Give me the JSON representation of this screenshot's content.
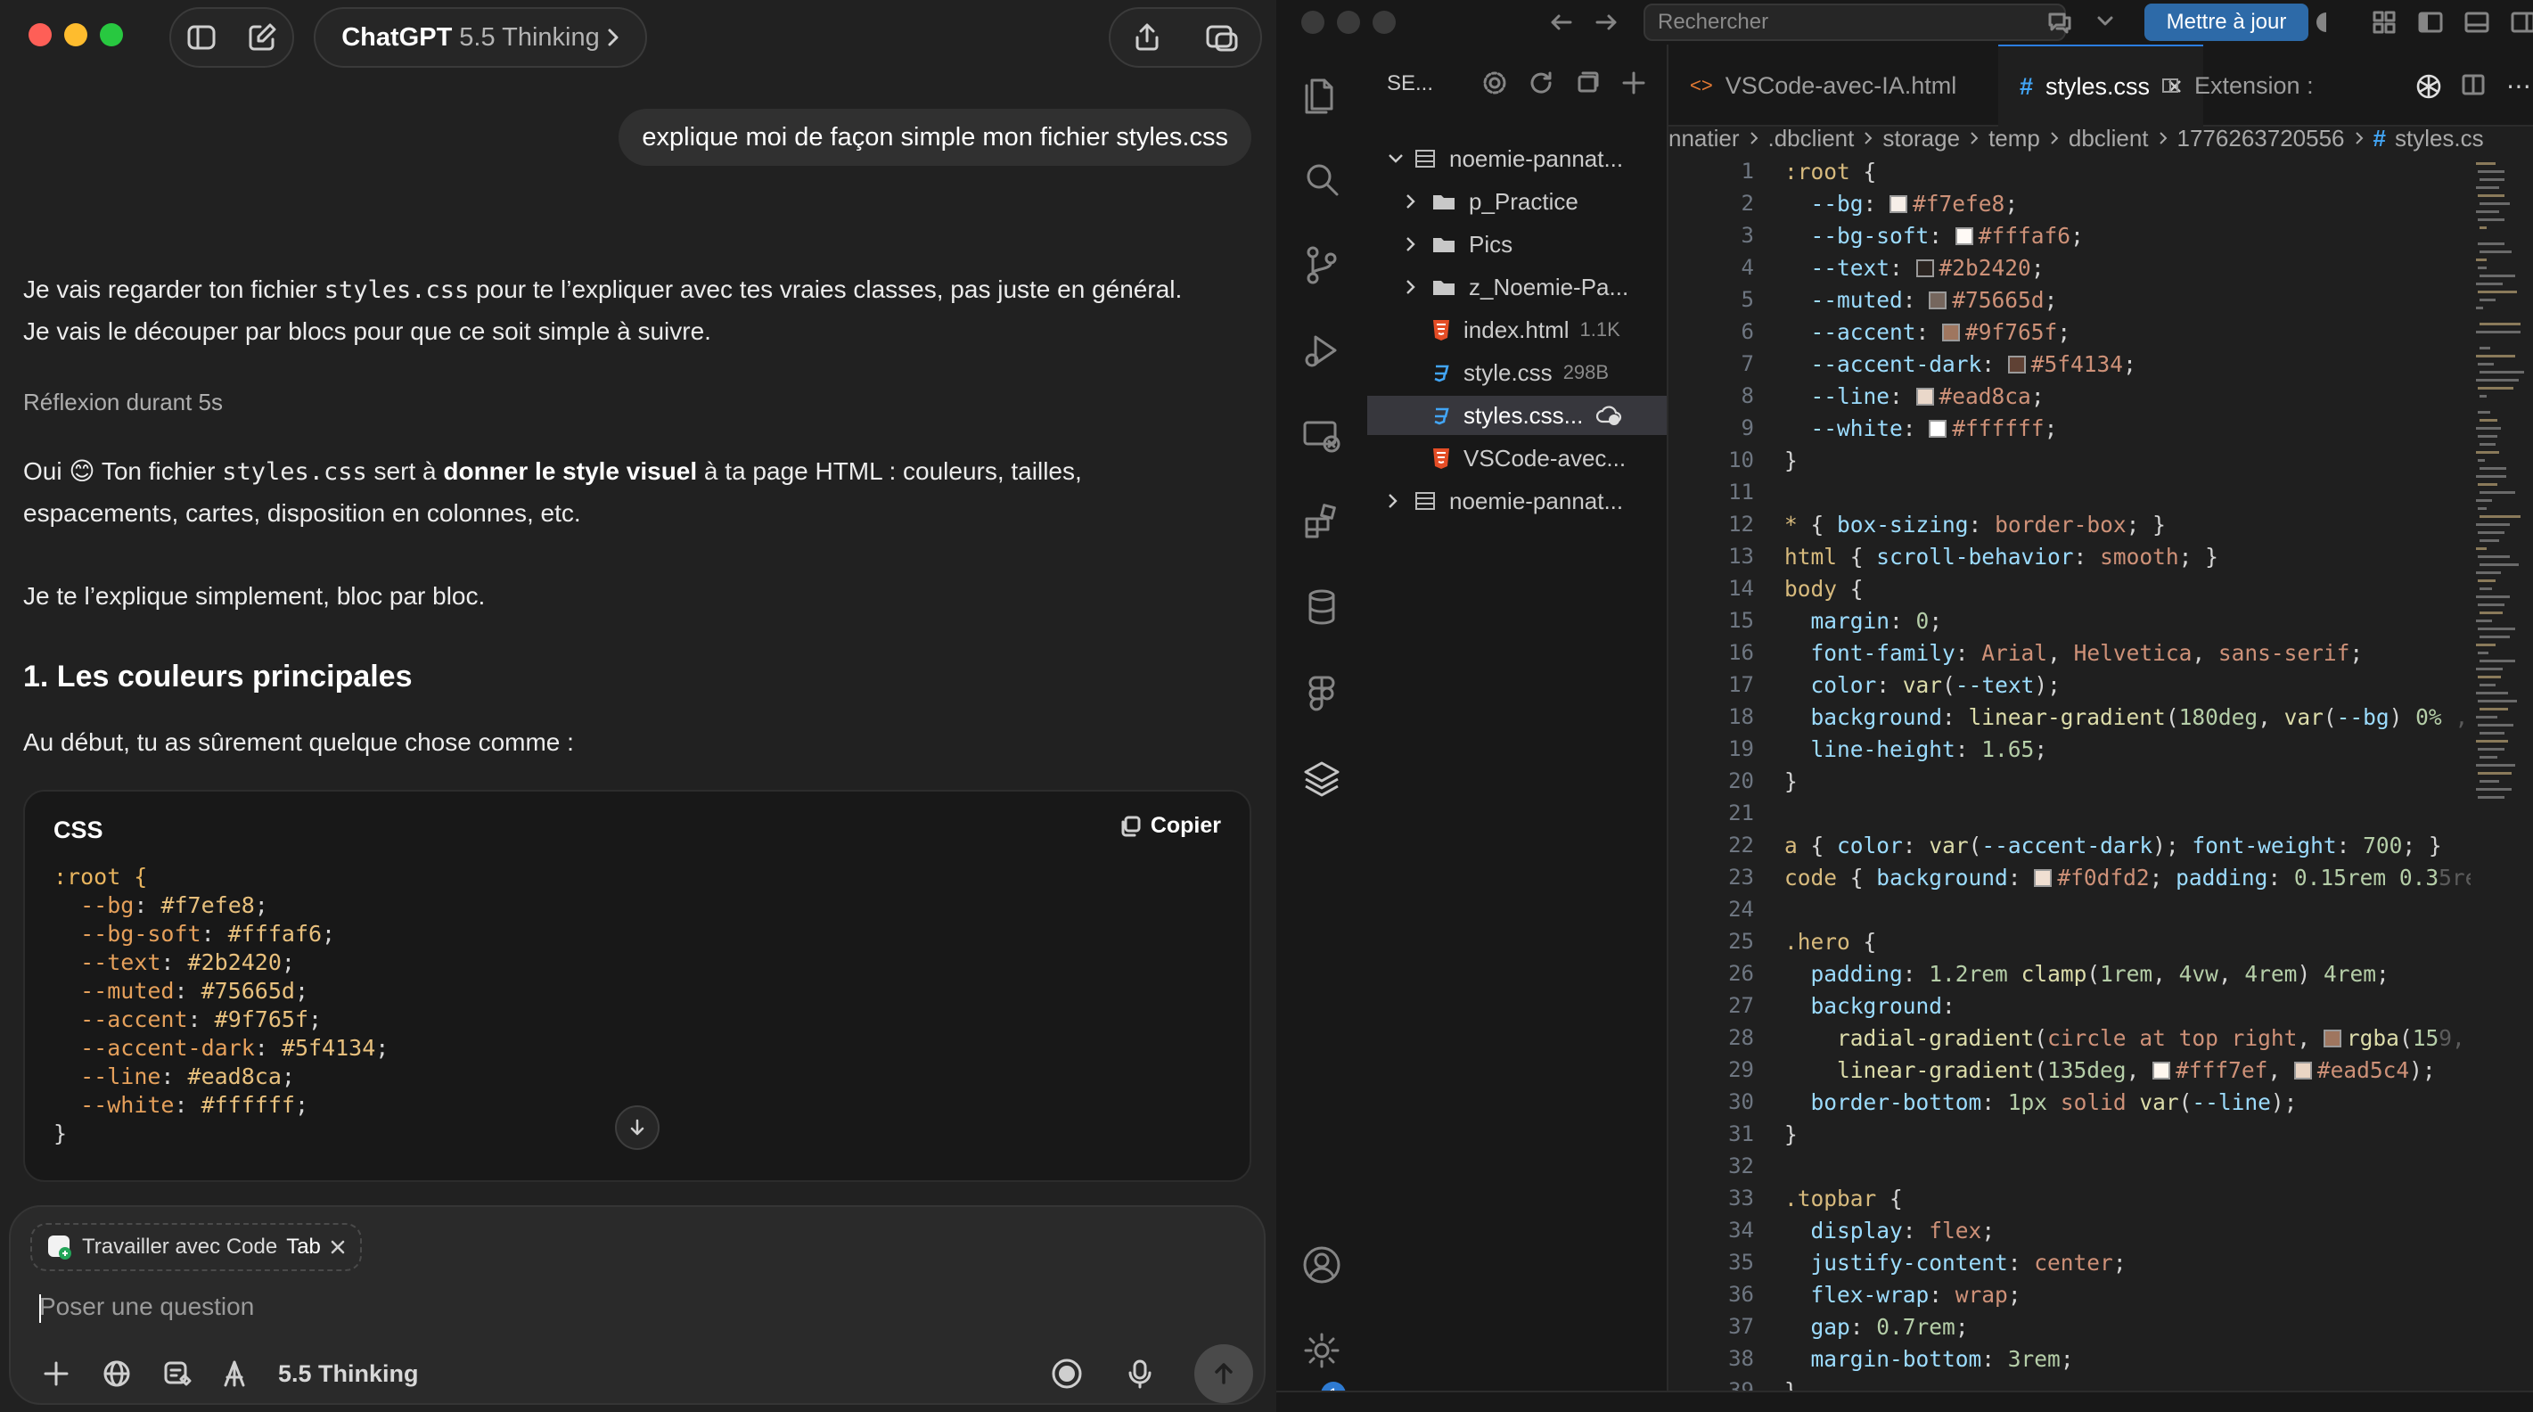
{
  "chat": {
    "model_name": "ChatGPT",
    "model_variant": "5.5 Thinking",
    "user_message": "explique moi de façon simple mon fichier styles.css",
    "intro": {
      "p1_a": "Je vais regarder ton fichier ",
      "p1_code": "styles.css",
      "p1_b": " pour te l’expliquer avec tes vraies classes, pas juste en général.",
      "p2": "Je vais le découper par blocs pour que ce soit simple à suivre."
    },
    "reflexion": "Réflexion durant 5s",
    "answer": {
      "a1": "Oui 😊 Ton fichier ",
      "a1_code": "styles.css",
      "a1_b": " sert à ",
      "a1_bold": "donner le style visuel",
      "a1_c": " à ta page HTML : couleurs, tailles,",
      "a1_d": "espacements, cartes, disposition en colonnes, etc.",
      "a2": "Je te l’explique simplement, bloc par bloc.",
      "heading": "1. Les couleurs principales",
      "a3": "Au début, tu as sûrement quelque chose comme :"
    },
    "code": {
      "lang": "CSS",
      "copy_label": "Copier",
      "selector": ":root {",
      "vars": [
        {
          "k": "--bg",
          "v": "#f7efe8"
        },
        {
          "k": "--bg-soft",
          "v": "#fffaf6"
        },
        {
          "k": "--text",
          "v": "#2b2420"
        },
        {
          "k": "--muted",
          "v": "#75665d"
        },
        {
          "k": "--accent",
          "v": "#9f765f"
        },
        {
          "k": "--accent-dark",
          "v": "#5f4134"
        },
        {
          "k": "--line",
          "v": "#ead8ca"
        },
        {
          "k": "--white",
          "v": "#ffffff"
        }
      ],
      "close": "}"
    },
    "composer": {
      "chip_label": "Travailler avec Code",
      "chip_tab": "Tab",
      "placeholder": "Poser une question",
      "thinking_label": "5.5 Thinking"
    }
  },
  "vscode": {
    "search_placeholder": "Rechercher",
    "update_label": "Mettre à jour",
    "sidebar_title": "SE...",
    "tree": [
      {
        "label": "noemie-pannat...",
        "kind": "workspace",
        "depth": 0,
        "chevron": "down",
        "size": ""
      },
      {
        "label": "p_Practice",
        "kind": "folder",
        "depth": 1,
        "chevron": "right",
        "size": ""
      },
      {
        "label": "Pics",
        "kind": "folder",
        "depth": 1,
        "chevron": "right",
        "size": ""
      },
      {
        "label": "z_Noemie-Pa...",
        "kind": "folder",
        "depth": 1,
        "chevron": "right",
        "size": ""
      },
      {
        "label": "index.html",
        "kind": "html",
        "depth": 1,
        "chevron": "",
        "size": "1.1K"
      },
      {
        "label": "style.css",
        "kind": "css",
        "depth": 1,
        "chevron": "",
        "size": "298B"
      },
      {
        "label": "styles.css...",
        "kind": "css",
        "depth": 1,
        "chevron": "",
        "size": ""
      },
      {
        "label": "VSCode-avec...",
        "kind": "html",
        "depth": 1,
        "chevron": "",
        "size": ""
      },
      {
        "label": "noemie-pannat...",
        "kind": "workspace",
        "depth": 0,
        "chevron": "right",
        "size": ""
      }
    ],
    "tabs": [
      {
        "label": "VSCode-avec-IA.html",
        "icon": "<>"
      },
      {
        "label": "styles.css",
        "icon": "#"
      },
      {
        "label": "Extension :",
        "icon": "⊞"
      }
    ],
    "breadcrumb": [
      "nnatier",
      ".dbclient",
      "storage",
      "temp",
      "dbclient",
      "1776263720556",
      "styles.cs"
    ],
    "colors": {
      "accent": "#2b7de0",
      "update": "#2d6aa8",
      "badge": "#2e7ad1"
    }
  }
}
